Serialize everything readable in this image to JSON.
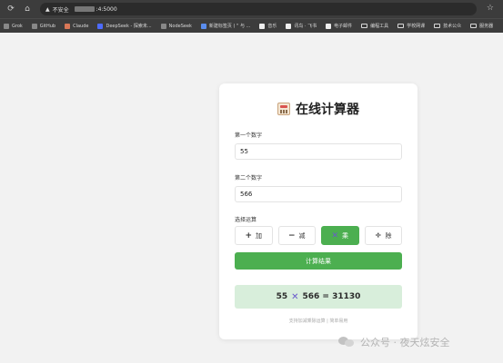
{
  "browser": {
    "security_label": "不安全",
    "url_suffix": ":4:5000",
    "bookmarks": [
      {
        "label": "Grok",
        "icon": "grok-icon"
      },
      {
        "label": "GitHub",
        "icon": "github-icon"
      },
      {
        "label": "Claude",
        "icon": "claude-icon"
      },
      {
        "label": "DeepSeek - 探索未...",
        "icon": "deepseek-icon"
      },
      {
        "label": "NodeSeek",
        "icon": "nodeseek-icon"
      },
      {
        "label": "新建标签页 ( \" 与 ...",
        "icon": "tab-icon"
      },
      {
        "label": "音乐",
        "icon": "music-icon"
      },
      {
        "label": "讯鸟 · 飞书",
        "icon": "feishu-icon"
      },
      {
        "label": "电子邮件",
        "icon": "mail-icon"
      },
      {
        "label": "编程工具",
        "icon": "folder-icon"
      },
      {
        "label": "学校网课",
        "icon": "folder-icon"
      },
      {
        "label": "技术公众",
        "icon": "folder-icon"
      },
      {
        "label": "服务器",
        "icon": "folder-icon"
      }
    ]
  },
  "calculator": {
    "title": "在线计算器",
    "first_label": "第一个数字",
    "first_value": "55",
    "second_label": "第二个数字",
    "second_value": "566",
    "op_label": "选择运算",
    "ops": [
      {
        "symbol": "+",
        "label": "加"
      },
      {
        "symbol": "−",
        "label": "减"
      },
      {
        "symbol": "✕",
        "label": "乘"
      },
      {
        "symbol": "÷",
        "label": "除"
      }
    ],
    "active_op": "乘",
    "submit_label": "计算结果",
    "result_left": "55",
    "result_symbol": "✕",
    "result_right": "566 = 31130",
    "footer": "支持加减乘除运算 | 简单易用"
  },
  "watermark": {
    "text": "公众号 · 夜天炫安全"
  },
  "colors": {
    "accent": "#4caf50",
    "result_bg": "#d8eedb",
    "page_bg": "#f2f2f2"
  }
}
